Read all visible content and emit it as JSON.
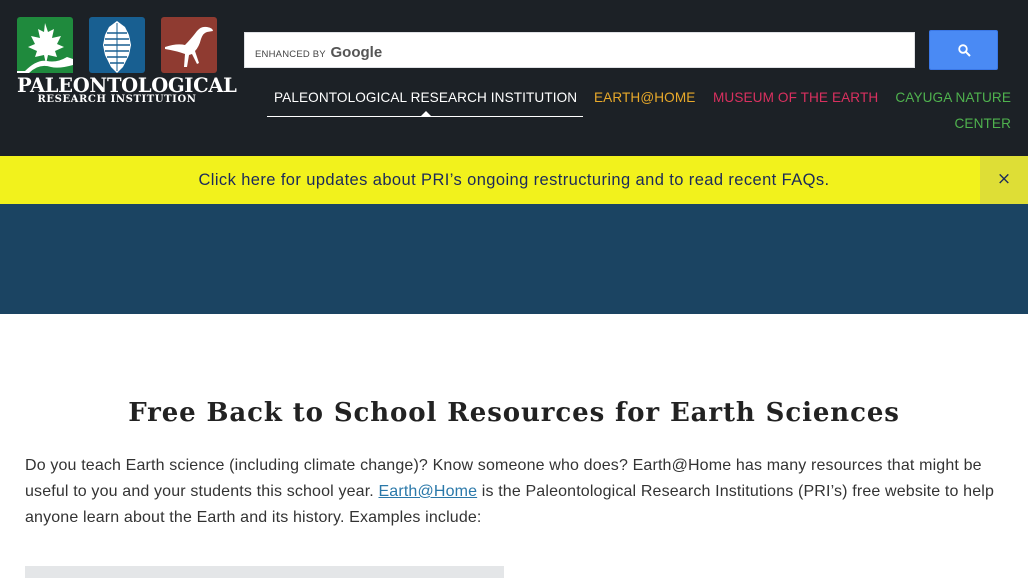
{
  "logo": {
    "main": "PALEONTOLOGICAL",
    "sub": "RESEARCH INSTITUTION"
  },
  "search": {
    "enhanced_by": "ENHANCED BY",
    "brand": "Google"
  },
  "nav": {
    "pri": "PALEONTOLOGICAL RESEARCH INSTITUTION",
    "earth": "EARTH@HOME",
    "museum": "MUSEUM OF THE EARTH",
    "cayuga_line1": "CAYUGA NATURE",
    "cayuga_line2": "CENTER"
  },
  "banner": {
    "text": "Click here for updates about PRI’s ongoing restructuring and to read recent FAQs.",
    "close": "×"
  },
  "content": {
    "title": "Free Back to School Resources for Earth Sciences",
    "intro_part1": "Do you teach Earth science (including climate change)? Know someone who does? Earth@Home has many resources that might be useful to you and your students this school year. ",
    "intro_link": "Earth@Home",
    "intro_part2": " is the Paleontological Research Institutions (PRI’s) free website to help anyone learn about the Earth and its history. Examples include:"
  },
  "colors": {
    "header_bg": "#1c2126",
    "banner_bg": "#f2f21c",
    "hero_bg": "#1b4462",
    "nav_earth": "#e8a92a",
    "nav_museum": "#d9305f",
    "nav_cayuga": "#4fb24e",
    "link": "#2a78a9"
  }
}
